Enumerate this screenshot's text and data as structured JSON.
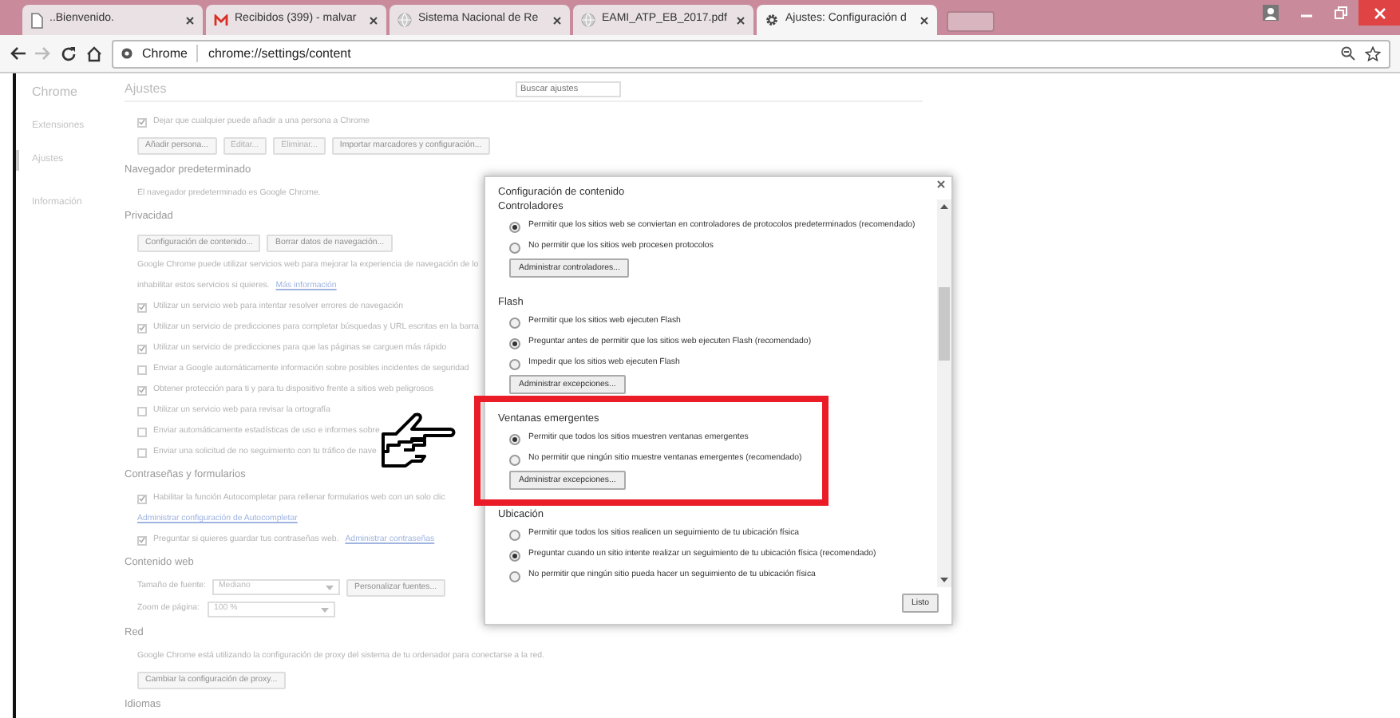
{
  "browser": {
    "tabs": [
      {
        "title": "..Bienvenido.",
        "kind": "page",
        "selected": false
      },
      {
        "title": "Recibidos (399) - malvar",
        "kind": "mail",
        "selected": false
      },
      {
        "title": "Sistema Nacional de Re",
        "kind": "web",
        "selected": false
      },
      {
        "title": "EAMI_ATP_EB_2017.pdf",
        "kind": "web",
        "selected": false
      },
      {
        "title": "Ajustes: Configuración d",
        "kind": "settings",
        "selected": true
      }
    ],
    "url_chip": "Chrome",
    "url": "chrome://settings/content"
  },
  "sidebar": {
    "title": "Chrome",
    "items": [
      {
        "label": "Extensiones",
        "selected": false
      },
      {
        "label": "Ajustes",
        "selected": true
      },
      {
        "label": "Información",
        "selected": false
      }
    ]
  },
  "settings": {
    "title": "Ajustes",
    "search": {
      "placeholder": "Buscar ajustes"
    },
    "blocks": [
      {
        "kind": "check",
        "label": "Dejar que cualquier puede añadir a una persona a Chrome",
        "checked": true
      },
      {
        "kind": "buttons",
        "buttons": [
          {
            "label": "Añadir persona...",
            "disabled": false
          },
          {
            "label": "Editar...",
            "disabled": true
          },
          {
            "label": "Eliminar...",
            "disabled": true
          },
          {
            "label": "Importar marcadores y configuración...",
            "disabled": false
          }
        ]
      },
      {
        "kind": "heading",
        "text": "Navegador predeterminado"
      },
      {
        "kind": "text",
        "text": "El navegador predeterminado es Google Chrome."
      },
      {
        "kind": "heading",
        "text": "Privacidad"
      },
      {
        "kind": "buttons",
        "buttons": [
          {
            "label": "Configuración de contenido...",
            "disabled": false
          },
          {
            "label": "Borrar datos de navegación...",
            "disabled": false
          }
        ]
      },
      {
        "kind": "text",
        "text": "Google Chrome puede utilizar servicios web para mejorar la experiencia de navegación de lo"
      },
      {
        "kind": "text",
        "text": "inhabilitar estos servicios si quieres.",
        "link": "Más información"
      },
      {
        "kind": "check",
        "label": "Utilizar un servicio web para intentar resolver errores de navegación",
        "checked": true
      },
      {
        "kind": "check",
        "label": "Utilizar un servicio de predicciones para completar búsquedas y URL escritas en la barra",
        "checked": true
      },
      {
        "kind": "check",
        "label": "Utilizar un servicio de predicciones para que las páginas se carguen más rápido",
        "checked": true
      },
      {
        "kind": "check",
        "label": "Enviar a Google automáticamente información sobre posibles incidentes de seguridad",
        "checked": false
      },
      {
        "kind": "check",
        "label": "Obtener protección para ti y para tu dispositivo frente a sitios web peligrosos",
        "checked": true
      },
      {
        "kind": "check",
        "label": "Utilizar un servicio web para revisar la ortografía",
        "checked": false
      },
      {
        "kind": "check",
        "label": "Enviar automáticamente estadísticas de uso e informes sobre",
        "checked": false
      },
      {
        "kind": "check",
        "label": "Enviar una solicitud de no seguimiento con tu tráfico de nave",
        "checked": false
      },
      {
        "kind": "heading",
        "text": "Contraseñas y formularios"
      },
      {
        "kind": "check",
        "label": "Habilitar la función Autocompletar para rellenar formularios web con un solo clic",
        "checked": true
      },
      {
        "kind": "link",
        "text": "Administrar configuración de Autocompletar"
      },
      {
        "kind": "check",
        "label": "Preguntar si quieres guardar tus contraseñas web.",
        "checked": true,
        "link": "Administrar contraseñas"
      },
      {
        "kind": "heading",
        "text": "Contenido web"
      },
      {
        "kind": "select",
        "label": "Tamaño de fuente:",
        "value": "Mediano",
        "button": "Personalizar fuentes..."
      },
      {
        "kind": "select",
        "label": "Zoom de página:",
        "value": "100 %"
      },
      {
        "kind": "heading",
        "text": "Red"
      },
      {
        "kind": "text",
        "text": "Google Chrome está utilizando la configuración de proxy del sistema de tu ordenador para conectarse a la red."
      },
      {
        "kind": "buttons",
        "buttons": [
          {
            "label": "Cambiar la configuración de proxy...",
            "disabled": false
          }
        ]
      },
      {
        "kind": "heading",
        "text": "Idiomas"
      }
    ]
  },
  "dialog": {
    "title": "Configuración de contenido",
    "sections": [
      {
        "title": "Controladores",
        "options": [
          {
            "label": "Permitir que los sitios web se conviertan en controladores de protocolos predeterminados (recomendado)",
            "selected": true
          },
          {
            "label": "No permitir que los sitios web procesen protocolos",
            "selected": false
          }
        ],
        "button": "Administrar controladores..."
      },
      {
        "title": "Flash",
        "options": [
          {
            "label": "Permitir que los sitios web ejecuten Flash",
            "selected": false
          },
          {
            "label": "Preguntar antes de permitir que los sitios web ejecuten Flash (recomendado)",
            "selected": true
          },
          {
            "label": "Impedir que los sitios web ejecuten Flash",
            "selected": false
          }
        ],
        "button": "Administrar excepciones..."
      },
      {
        "title": "Ventanas emergentes",
        "highlighted": true,
        "options": [
          {
            "label": "Permitir que todos los sitios muestren ventanas emergentes",
            "selected": true
          },
          {
            "label": "No permitir que ningún sitio muestre ventanas emergentes (recomendado)",
            "selected": false
          }
        ],
        "button": "Administrar excepciones..."
      },
      {
        "title": "Ubicación",
        "options": [
          {
            "label": "Permitir que todos los sitios realicen un seguimiento de tu ubicación física",
            "selected": false
          },
          {
            "label": "Preguntar cuando un sitio intente realizar un seguimiento de tu ubicación física (recomendado)",
            "selected": true
          },
          {
            "label": "No permitir que ningún sitio pueda hacer un seguimiento de tu ubicación física",
            "selected": false
          }
        ]
      }
    ],
    "done_button": "Listo"
  }
}
